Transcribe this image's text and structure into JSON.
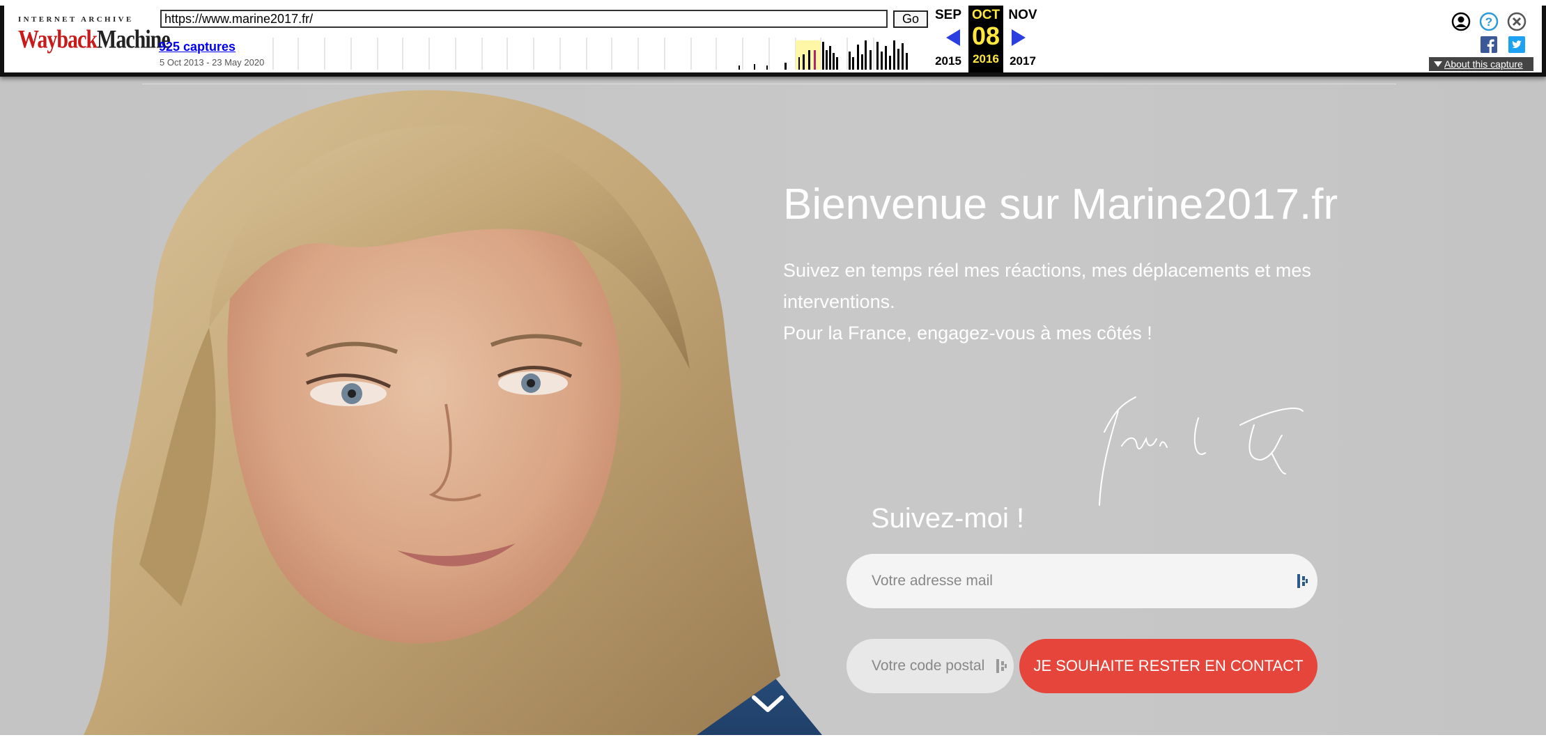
{
  "wayback": {
    "logo_top": "INTERNET ARCHIVE",
    "logo_a": "Wayback",
    "logo_b": "Machine",
    "url": "https://www.marine2017.fr/",
    "go_label": "Go",
    "captures": "925 captures",
    "range": "5 Oct 2013 - 23 May 2020",
    "prev_month": "SEP",
    "cur_month": "OCT",
    "next_month": "NOV",
    "cur_day": "08",
    "prev_year": "2015",
    "cur_year": "2016",
    "next_year": "2017",
    "about": "About this capture",
    "icons": [
      "user-icon",
      "help-icon",
      "close-icon",
      "facebook-icon",
      "twitter-icon"
    ],
    "accent_blue": "#2b3fe0",
    "highlight_yellow": "#ffe83e"
  },
  "hero": {
    "headline": "Bienvenue sur Marine2017.fr",
    "intro_line1": "Suivez en temps réel mes réactions, mes déplacements et mes interventions.",
    "intro_line2": "Pour la France, engagez-vous à mes côtés !",
    "follow_title": "Suivez-moi !",
    "email_placeholder": "Votre adresse mail",
    "postal_placeholder": "Votre code postal",
    "cta_label": "JE SOUHAITE RESTER EN CONTACT",
    "cta_color": "#e5453a"
  }
}
